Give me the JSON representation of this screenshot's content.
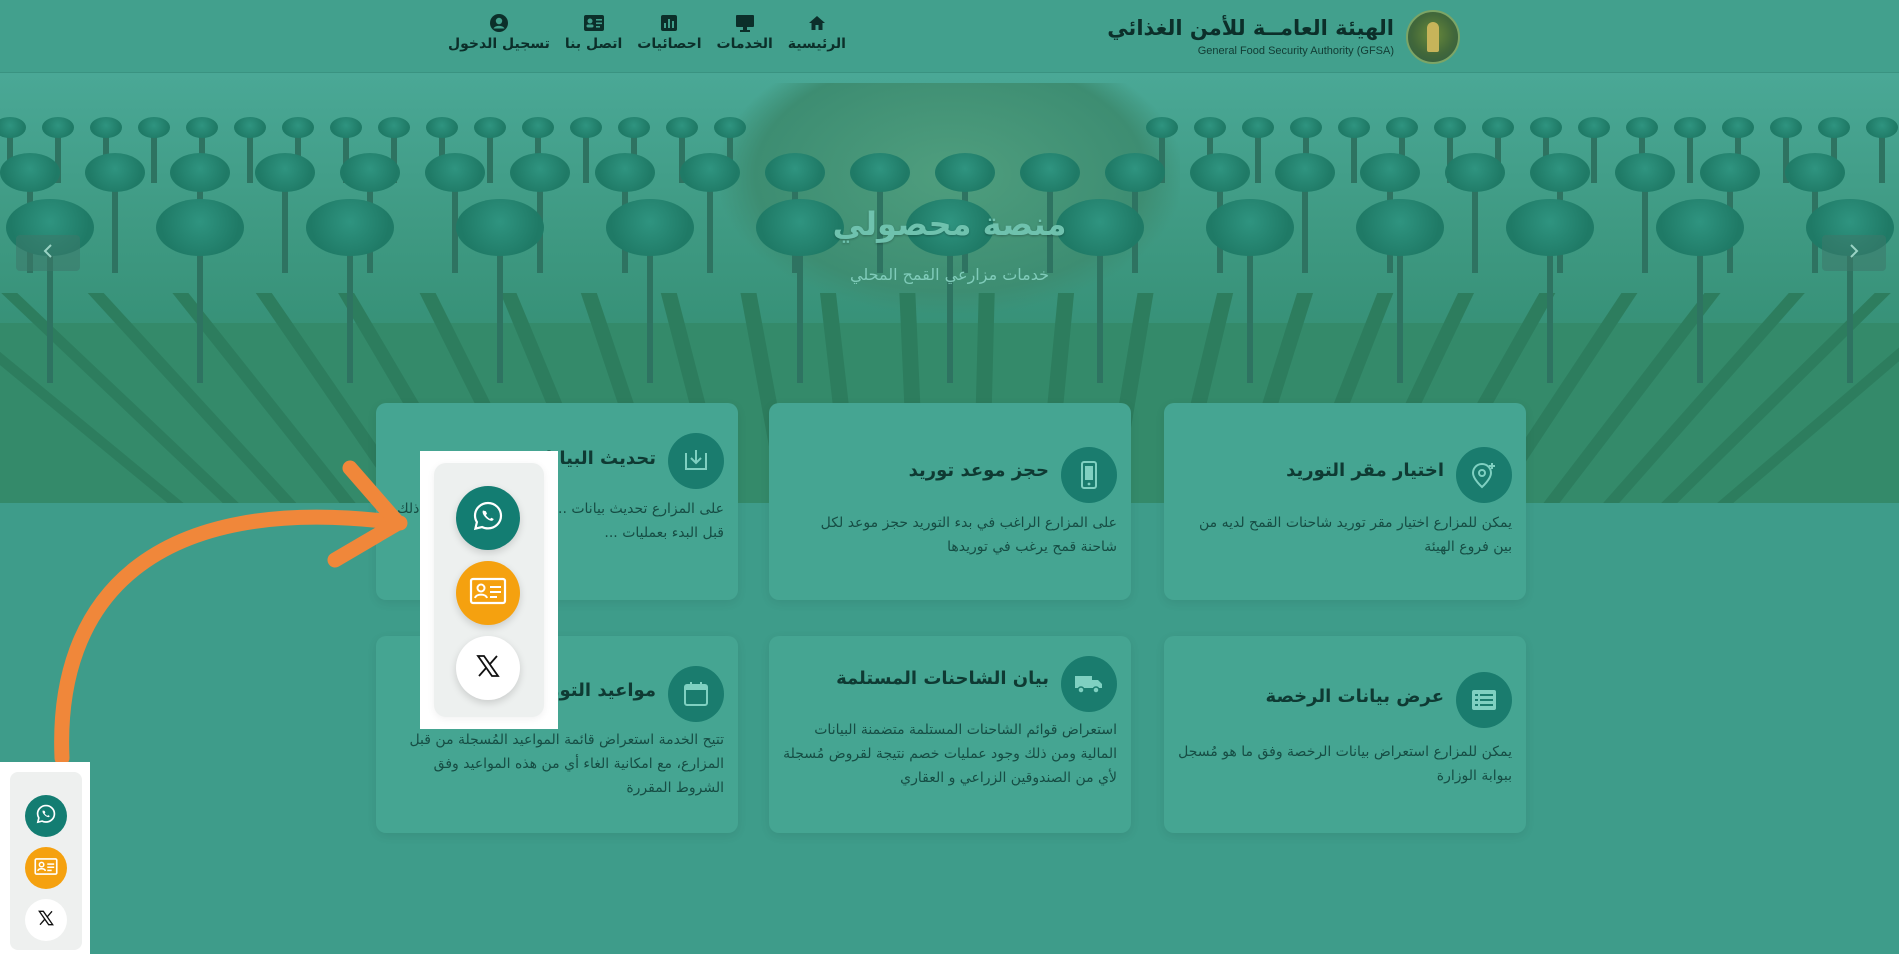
{
  "header": {
    "logo_ar": "الهيئة العامــة للأمن الغذائي",
    "logo_en": "General Food Security Authority (GFSA)",
    "nav": [
      {
        "label": "الرئيسية",
        "icon": "home-icon"
      },
      {
        "label": "الخدمات",
        "icon": "monitor-icon"
      },
      {
        "label": "احصائيات",
        "icon": "bar-chart-icon"
      },
      {
        "label": "اتصل بنا",
        "icon": "contact-card-icon"
      },
      {
        "label": "تسجيل الدخول",
        "icon": "user-icon"
      }
    ]
  },
  "hero": {
    "title": "منصة محصولي",
    "subtitle": "خدمات مزارعي القمح المحلي",
    "prev_icon": "chevron-left-icon",
    "next_icon": "chevron-right-icon"
  },
  "cards": [
    {
      "title": "اختيار مقر التوريد",
      "desc": "يمكن للمزارع اختيار مقر توريد شاحنات القمح لديه من بين فروع الهيئة",
      "icon": "location-pin-plus-icon"
    },
    {
      "title": "حجز موعد توريد",
      "desc": "على المزارع الراغب في بدء التوريد حجز موعد لكل شاحنة قمح يرغب في توريدها",
      "icon": "mobile-phone-icon"
    },
    {
      "title": "تحديث البيانات",
      "desc": "على المزارع تحديث بيانات ... رفع صورة الهوية و ... ذلك قبل البدء بعمليات ...",
      "icon": "download-tray-icon"
    },
    {
      "title": "عرض بيانات الرخصة",
      "desc": "يمكن للمزارع استعراض بيانات الرخصة وفق ما هو مُسجل ببوابة الوزارة",
      "icon": "list-icon"
    },
    {
      "title": "بيان الشاحنات المستلمة",
      "desc": "استعراض قوائم الشاحنات المستلمة متضمنة البيانات المالية ومن ذلك وجود عمليات خصم نتيجة لقروض مُسجلة لأي من الصندوقين الزراعي و العقاري",
      "icon": "truck-icon"
    },
    {
      "title": "مواعيد التوريد",
      "desc": "تتيح الخدمة استعراض قائمة المواعيد المُسجلة من قبل المزارع، مع امكانية الغاء أي من هذه المواعيد وفق الشروط المقررة",
      "icon": "calendar-icon"
    }
  ],
  "share": {
    "buttons": [
      {
        "icon": "whatsapp-icon",
        "color": "#137d72"
      },
      {
        "icon": "id-card-icon",
        "color": "#f5a10f"
      },
      {
        "icon": "x-logo-icon",
        "color": "#ffffff"
      }
    ]
  },
  "annotation": {
    "arrow_color": "#f0873a"
  }
}
